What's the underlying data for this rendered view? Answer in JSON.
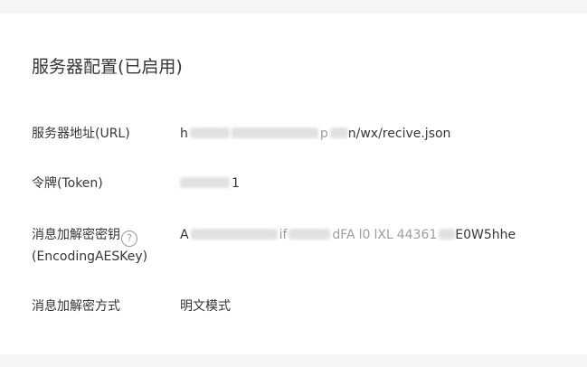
{
  "section": {
    "title": "服务器配置(已启用)"
  },
  "fields": {
    "url": {
      "label": "服务器地址(URL)",
      "value_prefix": "h",
      "value_mid": "p",
      "value_suffix": "n/wx/recive.json"
    },
    "token": {
      "label": "令牌(Token)",
      "value_suffix": "1"
    },
    "aes_key": {
      "label_line1": "消息加解密密钥",
      "label_line2": "(EncodingAESKey)",
      "help_glyph": "?",
      "value_prefix": "A",
      "value_frag1": "if",
      "value_frag2": "dFA",
      "value_frag3": "l0",
      "value_frag4": "lXL",
      "value_frag5": "44361",
      "value_suffix": "E0W5hhe"
    },
    "encrypt_mode": {
      "label": "消息加解密方式",
      "value": "明文模式"
    }
  }
}
